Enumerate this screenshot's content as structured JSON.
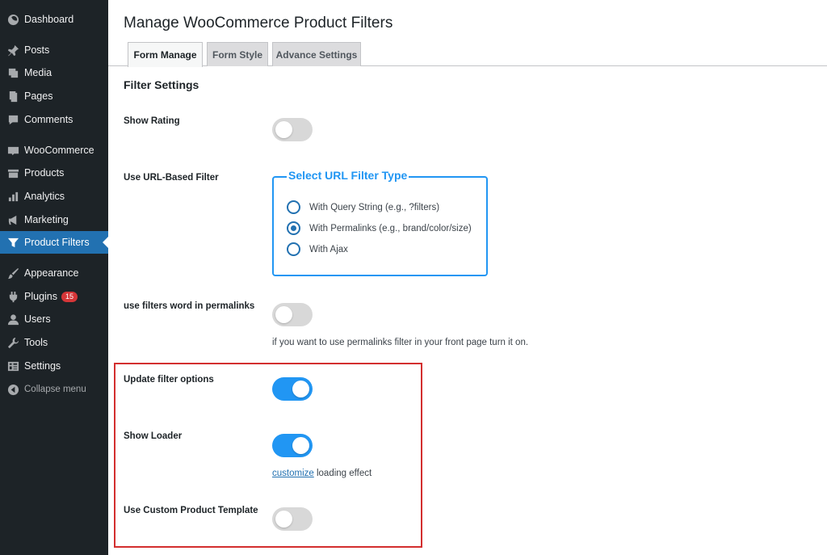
{
  "sidebar": {
    "items": [
      {
        "label": "Dashboard",
        "icon": "dashboard-icon"
      },
      {
        "label": "Posts",
        "icon": "pin-icon"
      },
      {
        "label": "Media",
        "icon": "media-icon"
      },
      {
        "label": "Pages",
        "icon": "pages-icon"
      },
      {
        "label": "Comments",
        "icon": "comments-icon"
      },
      {
        "label": "WooCommerce",
        "icon": "woo-icon"
      },
      {
        "label": "Products",
        "icon": "products-icon"
      },
      {
        "label": "Analytics",
        "icon": "analytics-icon"
      },
      {
        "label": "Marketing",
        "icon": "megaphone-icon"
      },
      {
        "label": "Product Filters",
        "icon": "filter-icon"
      },
      {
        "label": "Appearance",
        "icon": "brush-icon"
      },
      {
        "label": "Plugins",
        "icon": "plugin-icon",
        "badge": "15"
      },
      {
        "label": "Users",
        "icon": "user-icon"
      },
      {
        "label": "Tools",
        "icon": "wrench-icon"
      },
      {
        "label": "Settings",
        "icon": "settings-icon"
      },
      {
        "label": "Collapse menu",
        "icon": "collapse-icon"
      }
    ],
    "active": "Product Filters"
  },
  "header": {
    "title": "Manage WooCommerce Product Filters"
  },
  "tabs": [
    {
      "label": "Form Manage",
      "active": true
    },
    {
      "label": "Form Style",
      "active": false
    },
    {
      "label": "Advance Settings",
      "active": false
    }
  ],
  "section": {
    "title": "Filter Settings"
  },
  "settings": {
    "show_rating": {
      "label": "Show Rating",
      "on": false
    },
    "url_filter": {
      "label": "Use URL-Based Filter",
      "legend": "Select URL Filter Type",
      "options": [
        {
          "label": "With Query String (e.g., ?filters)",
          "checked": false
        },
        {
          "label": "With Permalinks (e.g., brand/color/size)",
          "checked": true
        },
        {
          "label": "With Ajax",
          "checked": false
        }
      ]
    },
    "filters_word": {
      "label": "use filters word in permalinks",
      "on": false,
      "help": "if you want to use permalinks filter in your front page turn it on."
    },
    "update_options": {
      "label": "Update filter options",
      "on": true
    },
    "show_loader": {
      "label": "Show Loader",
      "on": true,
      "help_link": "customize",
      "help_rest": " loading effect"
    },
    "custom_template": {
      "label": "Use Custom Product Template",
      "on": false
    }
  },
  "colors": {
    "sidebar_bg": "#1d2327",
    "active_menu": "#2271b1",
    "toggle_on": "#2196f3",
    "highlight": "#d32f2f"
  }
}
